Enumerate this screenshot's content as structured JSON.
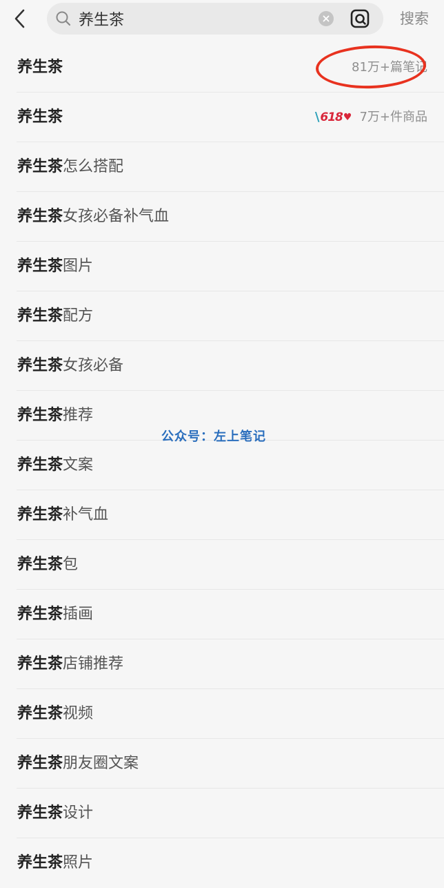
{
  "header": {
    "search_query": "养生茶",
    "search_button_label": "搜索"
  },
  "suggestions": [
    {
      "keyword": "养生茶",
      "suffix": "",
      "meta": "81万+篇笔记"
    },
    {
      "keyword": "养生茶",
      "suffix": "",
      "meta": "7万+件商品",
      "badge": "618"
    },
    {
      "keyword": "养生茶",
      "suffix": "怎么搭配",
      "meta": ""
    },
    {
      "keyword": "养生茶",
      "suffix": "女孩必备补气血",
      "meta": ""
    },
    {
      "keyword": "养生茶",
      "suffix": "图片",
      "meta": ""
    },
    {
      "keyword": "养生茶",
      "suffix": "配方",
      "meta": ""
    },
    {
      "keyword": "养生茶",
      "suffix": "女孩必备",
      "meta": ""
    },
    {
      "keyword": "养生茶",
      "suffix": "推荐",
      "meta": ""
    },
    {
      "keyword": "养生茶",
      "suffix": "文案",
      "meta": ""
    },
    {
      "keyword": "养生茶",
      "suffix": "补气血",
      "meta": ""
    },
    {
      "keyword": "养生茶",
      "suffix": "包",
      "meta": ""
    },
    {
      "keyword": "养生茶",
      "suffix": "插画",
      "meta": ""
    },
    {
      "keyword": "养生茶",
      "suffix": "店铺推荐",
      "meta": ""
    },
    {
      "keyword": "养生茶",
      "suffix": "视频",
      "meta": ""
    },
    {
      "keyword": "养生茶",
      "suffix": "朋友圈文案",
      "meta": ""
    },
    {
      "keyword": "养生茶",
      "suffix": "设计",
      "meta": ""
    },
    {
      "keyword": "养生茶",
      "suffix": "照片",
      "meta": ""
    }
  ],
  "watermark": "公众号：左上笔记",
  "colors": {
    "highlight_ring": "#e8321f",
    "badge_red": "#d9263a",
    "watermark_blue": "#2a6ebd"
  }
}
